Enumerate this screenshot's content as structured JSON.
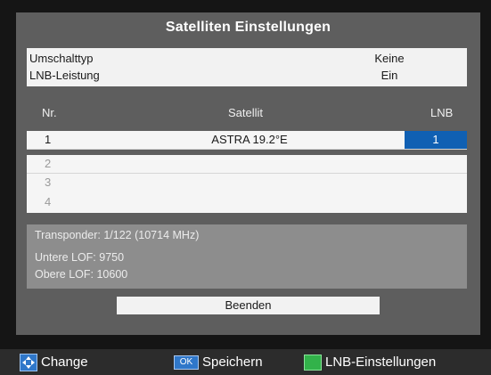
{
  "title": "Satelliten Einstellungen",
  "settings": [
    {
      "label": "Umschalttyp",
      "value": "Keine"
    },
    {
      "label": "LNB-Leistung",
      "value": "Ein"
    }
  ],
  "columns": {
    "nr": "Nr.",
    "satellite": "Satellit",
    "lnb": "LNB"
  },
  "rows": [
    {
      "nr": "1",
      "satellite": "ASTRA 19.2°E",
      "lnb": "1"
    },
    {
      "nr": "2",
      "satellite": "",
      "lnb": ""
    },
    {
      "nr": "3",
      "satellite": "",
      "lnb": ""
    },
    {
      "nr": "4",
      "satellite": "",
      "lnb": ""
    }
  ],
  "info": {
    "transponder": "Transponder: 1/122 (10714 MHz)",
    "lower_lof": "Untere LOF: 9750",
    "upper_lof": "Obere LOF: 10600"
  },
  "exit_button": "Beenden",
  "legend": [
    {
      "key": "nav-arrows-icon",
      "label": "Change"
    },
    {
      "key": "ok-key",
      "key_text": "OK",
      "label": "Speichern"
    },
    {
      "key": "green-key",
      "label": "LNB-Einstellungen"
    }
  ],
  "colors": {
    "background": "#151515",
    "panel": "#5e5e5e",
    "selection": "#1060b3",
    "info_box": "#8d8d8d",
    "green_key": "#32b24a",
    "blue_key": "#2f77c9"
  }
}
